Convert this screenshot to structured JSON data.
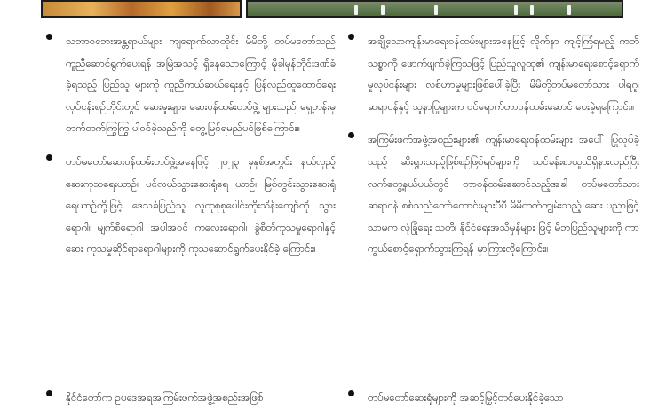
{
  "left_column": {
    "items": [
      "သဘာဝဘေးအန္တရာယ်များ ကျရောက်လာတိုင်း မိမိတို့ တပ်မတော်သည် ကူညီဆောင်ရွက်ပေးရန် အမြဲအသင့် ရှိနေသောကြောင့် မိုခါမုန်တိုင်းဒဏ်ခံခဲ့ရသည့် ပြည်သူ များကို ကူညီကယ်ဆယ်ရေးနှင့် ပြန်လည်ထူထောင်ရေး လုပ်ငန်းစဉ်တိုင်းတွင် ဆေးမှူးများ၊ ဆေးဝန်ထမ်းတပ်ဖွဲ့ များသည် ရှေ့တန်းမှ တက်တက်ကြွကြွ ပါဝင်ခဲ့သည်ကို တွေ့မြင်ရမည်ပင်ဖြစ်ကြောင်း။",
      "တပ်မတော်ဆေးဝန်ထမ်းတပ်ဖွဲ့အနေဖြင့် ၂၀၂၃ ခုနှစ်အတွင်း နယ်လှည့်ဆေးကုသရေးယာဉ်၊ ပင်လယ်သွားဆေးရုံရေ ယာဉ်၊ မြစ်တွင်းသွားဆေးရုံရေယာဉ်တို့ဖြင့် ဒေသခံပြည်သူ လူထုစုစုပေါင်းကိုးသိန်းကျော်ကို သွားရောဂါ၊ မျက်စိရောဂါ အပါအဝင် ကလေးရောဂါ၊ ခွဲစိတ်ကုသမှုရောဂါနှင့် ဆေး ကုသမှုဆိုင်ရာရောဂါများကို ကုသဆောင်ရွက်ပေးနိုင်ခဲ့ ကြောင်း။",
      "နိုင်ငံတော်က ဥပဒေအရအကြမ်းဖက်အဖွဲ့အစည်းအဖြစ်"
    ]
  },
  "right_column": {
    "items": [
      "အချို့သောကျန်းမာရေးဝန်ထမ်းများအနေဖြင့် လိုက်နာ ကျင့်ကြံရမည့် ကတိသစ္စာကို ဖောက်ဖျက်ခဲ့ကြသဖြင့် ပြည်သူလူထု၏ ကျန်းမာရေးစောင့်ရှောက်မှုလုပ်ငန်းများ လစ်ဟာမှုများဖြစ်ပေါ်ခဲ့ပြီး မိမိတို့တပ်မတော်သား ပါရဂူ၊ ဆရာဝန်နှင့် သူနာပြုများက ဝင်ရောက်တာဝန်ထမ်းဆောင် ပေးခဲ့ရကြောင်း။",
      "အကြမ်းဖက်အဖွဲ့အစည်းများ၏ ကျန်းမာရေးဝန်ထမ်းများ အပေါ် ပြုလုပ်ခဲ့သည့် ဆိုးရွားသည့်ဖြစ်စဉ်ဖြစ်ရပ်များကို သင်ခန်းစာယူသိရှိနားလည်ပြီး လက်တွေ့နယ်ပယ်တွင် တာဝန်ထမ်းဆောင်သည့်အခါ တပ်မတော်သားဆရာဝန် စစ်သည်တော်ကောင်းများပီပီ မိမိတတ်ကျွမ်းသည့် ဆေး ပညာဖြင့်သာမက လုံခြုံရေး သတိ၊ နိုင်ငံရေးအသိမှန်များ ဖြင့် မိဘပြည်သူများကို ကာကွယ်စောင့်ရှောက်သွားကြရန် မှာကြားလိုကြောင်း။",
      "တပ်မတော်ဆေးရုံများကို အဆင့်မြှင့်တင်ပေးနိုင်ခဲ့သော"
    ]
  }
}
